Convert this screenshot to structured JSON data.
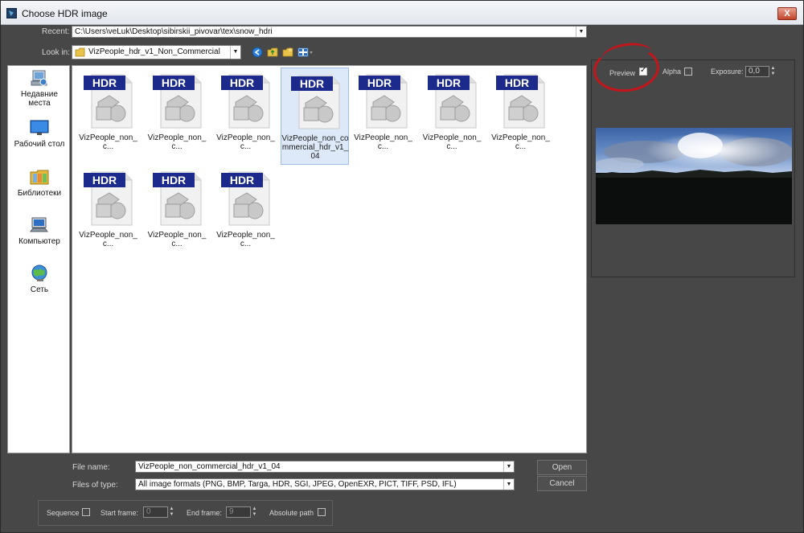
{
  "window": {
    "title": "Choose HDR image",
    "close_label": "X"
  },
  "recent": {
    "label": "Recent:",
    "value": "C:\\Users\\veLuk\\Desktop\\sibirskii_pivovar\\tex\\snow_hdri"
  },
  "lookin": {
    "label": "Look in:",
    "value": "VizPeople_hdr_v1_Non_Commercial"
  },
  "places": [
    {
      "label_line1": "Недавние",
      "label_line2": "места"
    },
    {
      "label_line1": "Рабочий стол",
      "label_line2": ""
    },
    {
      "label_line1": "Библиотеки",
      "label_line2": ""
    },
    {
      "label_line1": "Компьютер",
      "label_line2": ""
    },
    {
      "label_line1": "Сеть",
      "label_line2": ""
    }
  ],
  "file_badge": "HDR",
  "files": [
    {
      "name": "VizPeople_non_c..."
    },
    {
      "name": "VizPeople_non_c..."
    },
    {
      "name": "VizPeople_non_c..."
    },
    {
      "name": "VizPeople_non_commercial_hdr_v1_04"
    },
    {
      "name": "VizPeople_non_c..."
    },
    {
      "name": "VizPeople_non_c..."
    },
    {
      "name": "VizPeople_non_c..."
    },
    {
      "name": "VizPeople_non_c..."
    },
    {
      "name": "VizPeople_non_c..."
    },
    {
      "name": "VizPeople_non_c..."
    }
  ],
  "preview": {
    "preview_label": "Preview",
    "preview_checked": true,
    "alpha_label": "Alpha",
    "alpha_checked": false,
    "exposure_label": "Exposure:",
    "exposure_value": "0,0"
  },
  "filename": {
    "label": "File name:",
    "value": "VizPeople_non_commercial_hdr_v1_04"
  },
  "filetype": {
    "label": "Files of type:",
    "value": "All image formats (PNG, BMP, Targa, HDR, SGI, JPEG, OpenEXR, PICT, TIFF, PSD, IFL)"
  },
  "buttons": {
    "open": "Open",
    "cancel": "Cancel"
  },
  "sequence": {
    "sequence_label": "Sequence",
    "start_label": "Start frame:",
    "start_value": "0",
    "end_label": "End frame:",
    "end_value": "9",
    "absolute_label": "Absolute path"
  },
  "colors": {
    "accent_red": "#c4151b",
    "selection": "#dde9f8",
    "badge_blue": "#1c2a8c"
  }
}
